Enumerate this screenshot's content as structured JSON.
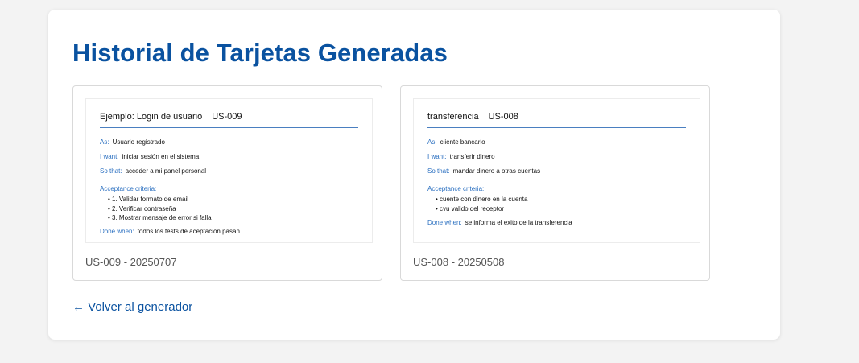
{
  "page": {
    "title": "Historial de Tarjetas Generadas",
    "back_link": "← Volver al generador"
  },
  "labels": {
    "as": "As:",
    "i_want": "I want:",
    "so_that": "So that:",
    "acceptance_criteria": "Acceptance criteria:",
    "done_when": "Done when:"
  },
  "cards": [
    {
      "story_title": "Ejemplo: Login de usuario",
      "story_id": "US-009",
      "as": "Usuario registrado",
      "i_want": "iniciar sesión en el sistema",
      "so_that": "acceder a mi panel personal",
      "criteria": [
        "1. Validar formato de email",
        "2. Verificar contraseña",
        "3. Mostrar mensaje de error si falla"
      ],
      "done_when": "todos los tests de aceptación pasan",
      "caption": "US-009 - 20250707"
    },
    {
      "story_title": "transferencia",
      "story_id": "US-008",
      "as": "cliente bancario",
      "i_want": "transferir dinero",
      "so_that": "mandar dinero a otras cuentas",
      "criteria": [
        "cuente con dinero en la cuenta",
        "cvu valido del receptor"
      ],
      "done_when": "se informa el exito de la transferencia",
      "caption": "US-008 - 20250508"
    }
  ],
  "colors": {
    "accent": "#0a52a0",
    "field_label": "#2a6fc0",
    "rule": "#4a7fc0",
    "background": "#f3f3f3"
  }
}
